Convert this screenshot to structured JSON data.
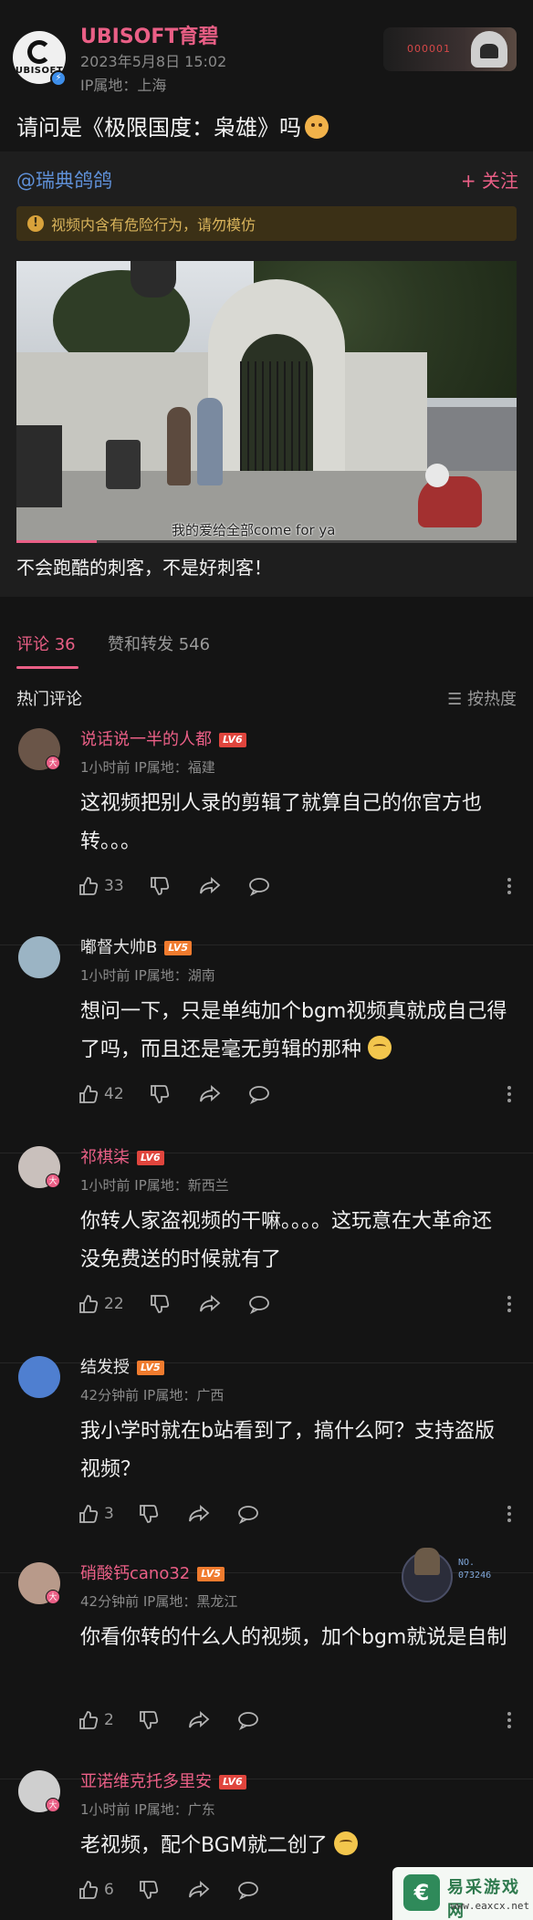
{
  "post": {
    "author": "UBISOFT育碧",
    "avatar_text": "UBISOFT",
    "date": "2023年5月8日 15:02",
    "ip": "IP属地：上海",
    "badge_no": "000001",
    "text": "请问是《极限国度：枭雄》吗"
  },
  "repost": {
    "user": "@瑞典鸽鸽",
    "follow": "+ 关注",
    "warning_icon": "!",
    "warning": "视频内含有危险行为，请勿模仿",
    "caption": "我的爱给全部come for ya",
    "progress": 0.16,
    "title": "不会跑酷的刺客，不是好刺客！"
  },
  "tabs": {
    "comments": "评论 36",
    "likes": "赞和转发 546"
  },
  "hot": {
    "label": "热门评论",
    "sort": "☰ 按热度"
  },
  "colors": {
    "accent": "#ea5f86",
    "link": "#5e8fd6",
    "bg": "#141414"
  },
  "comments": [
    {
      "name": "说话说一半的人都",
      "name_color": "#ea5f86",
      "level": "LV6",
      "meta": "1小时前  IP属地：福建",
      "text": "这视频把别人录的剪辑了就算自己的你官方也转。。。",
      "likes": "33",
      "avatar_color": "#6a5548",
      "has_badge": true
    },
    {
      "name": "嘟督大帅B",
      "name_color": "#e6e6e6",
      "level": "LV5",
      "meta": "1小时前  IP属地：湖南",
      "text": "想问一下，只是单纯加个bgm视频真就成自己得了吗，而且还是毫无剪辑的那种",
      "likes": "42",
      "avatar_color": "#9bb4c4",
      "has_badge": false
    },
    {
      "name": "祁棋柒",
      "name_color": "#ea5f86",
      "level": "LV6",
      "meta": "1小时前  IP属地：新西兰",
      "text": "你转人家盗视频的干嘛。。。。这玩意在大革命还没免费送的时候就有了",
      "likes": "22",
      "avatar_color": "#c9c0bc",
      "has_badge": true
    },
    {
      "name": "结发授",
      "name_color": "#e6e6e6",
      "level": "LV5",
      "meta": "42分钟前  IP属地：广西",
      "text": "我小学时就在b站看到了，搞什么阿？支持盗版视频？",
      "likes": "3",
      "avatar_color": "#4f7fd0",
      "has_badge": false
    },
    {
      "name": "硝酸钙cano32",
      "name_color": "#ea5f86",
      "level": "LV5",
      "meta": "42分钟前  IP属地：黑龙江",
      "text": "你看你转的什么人的视频，加个bgm就说是自制",
      "likes": "2",
      "avatar_color": "#b89a8a",
      "has_badge": true,
      "medal_no": "NO.\n073246"
    },
    {
      "name": "亚诺维克托多里安",
      "name_color": "#ea5f86",
      "level": "LV6",
      "meta": "1小时前  IP属地：广东",
      "text": "老视频，配个BGM就二创了",
      "likes": "6",
      "avatar_color": "#cfcfcf",
      "has_badge": true
    }
  ],
  "watermark": {
    "logo": "€",
    "name": "易采游戏网",
    "url": "www.eaxcx.net"
  }
}
